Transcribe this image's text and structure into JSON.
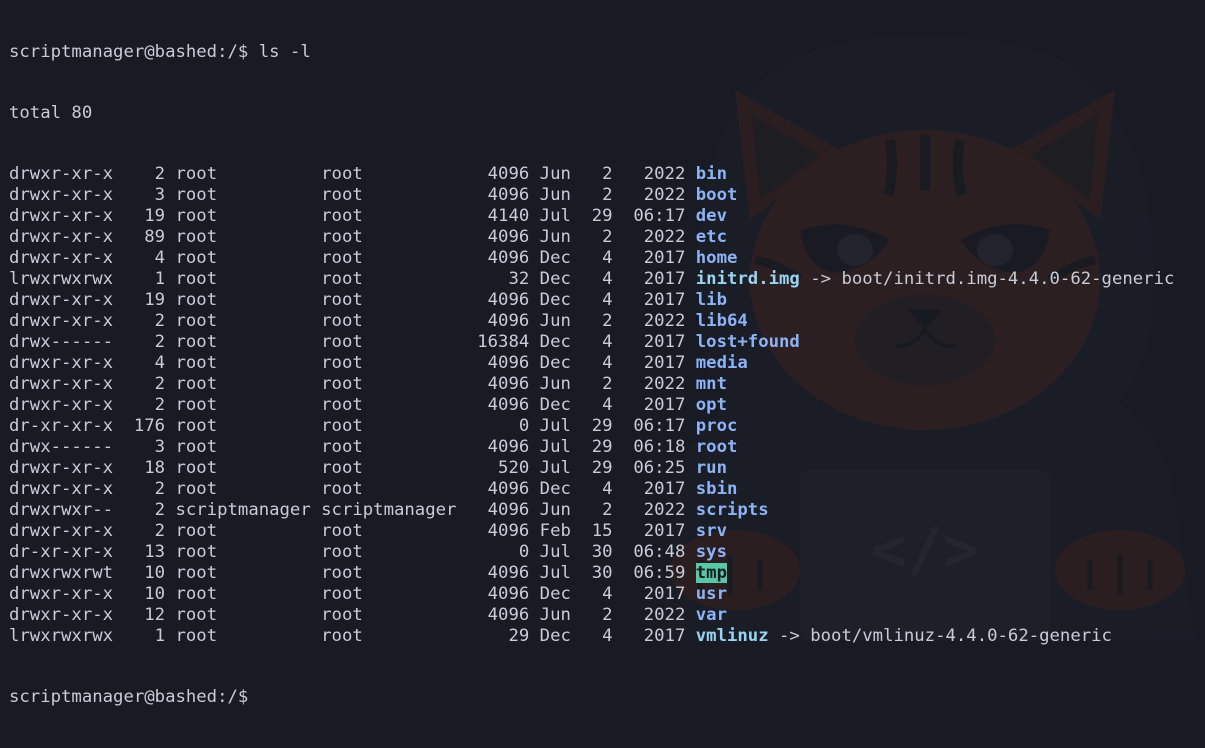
{
  "terminal": {
    "prompt": "scriptmanager@bashed:/$",
    "command": "ls -l",
    "total": "total 80",
    "entries": [
      {
        "perms": "drwxr-xr-x",
        "links": "2",
        "owner": "root",
        "group": "root",
        "size": "4096",
        "month": "Jun",
        "day": "2",
        "time_or_year": "2022",
        "name": "bin",
        "kind": "dir",
        "target": ""
      },
      {
        "perms": "drwxr-xr-x",
        "links": "3",
        "owner": "root",
        "group": "root",
        "size": "4096",
        "month": "Jun",
        "day": "2",
        "time_or_year": "2022",
        "name": "boot",
        "kind": "dir",
        "target": ""
      },
      {
        "perms": "drwxr-xr-x",
        "links": "19",
        "owner": "root",
        "group": "root",
        "size": "4140",
        "month": "Jul",
        "day": "29",
        "time_or_year": "06:17",
        "name": "dev",
        "kind": "dir",
        "target": ""
      },
      {
        "perms": "drwxr-xr-x",
        "links": "89",
        "owner": "root",
        "group": "root",
        "size": "4096",
        "month": "Jun",
        "day": "2",
        "time_or_year": "2022",
        "name": "etc",
        "kind": "dir",
        "target": ""
      },
      {
        "perms": "drwxr-xr-x",
        "links": "4",
        "owner": "root",
        "group": "root",
        "size": "4096",
        "month": "Dec",
        "day": "4",
        "time_or_year": "2017",
        "name": "home",
        "kind": "dir",
        "target": ""
      },
      {
        "perms": "lrwxrwxrwx",
        "links": "1",
        "owner": "root",
        "group": "root",
        "size": "32",
        "month": "Dec",
        "day": "4",
        "time_or_year": "2017",
        "name": "initrd.img",
        "kind": "link",
        "target": "boot/initrd.img-4.4.0-62-generic"
      },
      {
        "perms": "drwxr-xr-x",
        "links": "19",
        "owner": "root",
        "group": "root",
        "size": "4096",
        "month": "Dec",
        "day": "4",
        "time_or_year": "2017",
        "name": "lib",
        "kind": "dir",
        "target": ""
      },
      {
        "perms": "drwxr-xr-x",
        "links": "2",
        "owner": "root",
        "group": "root",
        "size": "4096",
        "month": "Jun",
        "day": "2",
        "time_or_year": "2022",
        "name": "lib64",
        "kind": "dir",
        "target": ""
      },
      {
        "perms": "drwx------",
        "links": "2",
        "owner": "root",
        "group": "root",
        "size": "16384",
        "month": "Dec",
        "day": "4",
        "time_or_year": "2017",
        "name": "lost+found",
        "kind": "dir",
        "target": ""
      },
      {
        "perms": "drwxr-xr-x",
        "links": "4",
        "owner": "root",
        "group": "root",
        "size": "4096",
        "month": "Dec",
        "day": "4",
        "time_or_year": "2017",
        "name": "media",
        "kind": "dir",
        "target": ""
      },
      {
        "perms": "drwxr-xr-x",
        "links": "2",
        "owner": "root",
        "group": "root",
        "size": "4096",
        "month": "Jun",
        "day": "2",
        "time_or_year": "2022",
        "name": "mnt",
        "kind": "dir",
        "target": ""
      },
      {
        "perms": "drwxr-xr-x",
        "links": "2",
        "owner": "root",
        "group": "root",
        "size": "4096",
        "month": "Dec",
        "day": "4",
        "time_or_year": "2017",
        "name": "opt",
        "kind": "dir",
        "target": ""
      },
      {
        "perms": "dr-xr-xr-x",
        "links": "176",
        "owner": "root",
        "group": "root",
        "size": "0",
        "month": "Jul",
        "day": "29",
        "time_or_year": "06:17",
        "name": "proc",
        "kind": "dir",
        "target": ""
      },
      {
        "perms": "drwx------",
        "links": "3",
        "owner": "root",
        "group": "root",
        "size": "4096",
        "month": "Jul",
        "day": "29",
        "time_or_year": "06:18",
        "name": "root",
        "kind": "dir",
        "target": ""
      },
      {
        "perms": "drwxr-xr-x",
        "links": "18",
        "owner": "root",
        "group": "root",
        "size": "520",
        "month": "Jul",
        "day": "29",
        "time_or_year": "06:25",
        "name": "run",
        "kind": "dir",
        "target": ""
      },
      {
        "perms": "drwxr-xr-x",
        "links": "2",
        "owner": "root",
        "group": "root",
        "size": "4096",
        "month": "Dec",
        "day": "4",
        "time_or_year": "2017",
        "name": "sbin",
        "kind": "dir",
        "target": ""
      },
      {
        "perms": "drwxrwxr--",
        "links": "2",
        "owner": "scriptmanager",
        "group": "scriptmanager",
        "size": "4096",
        "month": "Jun",
        "day": "2",
        "time_or_year": "2022",
        "name": "scripts",
        "kind": "dir",
        "target": ""
      },
      {
        "perms": "drwxr-xr-x",
        "links": "2",
        "owner": "root",
        "group": "root",
        "size": "4096",
        "month": "Feb",
        "day": "15",
        "time_or_year": "2017",
        "name": "srv",
        "kind": "dir",
        "target": ""
      },
      {
        "perms": "dr-xr-xr-x",
        "links": "13",
        "owner": "root",
        "group": "root",
        "size": "0",
        "month": "Jul",
        "day": "30",
        "time_or_year": "06:48",
        "name": "sys",
        "kind": "dir",
        "target": ""
      },
      {
        "perms": "drwxrwxrwt",
        "links": "10",
        "owner": "root",
        "group": "root",
        "size": "4096",
        "month": "Jul",
        "day": "30",
        "time_or_year": "06:59",
        "name": "tmp",
        "kind": "sticky",
        "target": ""
      },
      {
        "perms": "drwxr-xr-x",
        "links": "10",
        "owner": "root",
        "group": "root",
        "size": "4096",
        "month": "Dec",
        "day": "4",
        "time_or_year": "2017",
        "name": "usr",
        "kind": "dir",
        "target": ""
      },
      {
        "perms": "drwxr-xr-x",
        "links": "12",
        "owner": "root",
        "group": "root",
        "size": "4096",
        "month": "Jun",
        "day": "2",
        "time_or_year": "2022",
        "name": "var",
        "kind": "dir",
        "target": ""
      },
      {
        "perms": "lrwxrwxrwx",
        "links": "1",
        "owner": "root",
        "group": "root",
        "size": "29",
        "month": "Dec",
        "day": "4",
        "time_or_year": "2017",
        "name": "vmlinuz",
        "kind": "link",
        "target": "boot/vmlinuz-4.4.0-62-generic"
      }
    ],
    "link_arrow": "->"
  },
  "wallpaper": {
    "description_icon": "cat-mascot-icon",
    "code_glyph": "</>"
  },
  "colors": {
    "background": "#181a24",
    "text": "#c9cbd6",
    "directory": "#8db3f7",
    "symlink": "#97d5f2",
    "sticky_bg": "#57c7a4"
  }
}
